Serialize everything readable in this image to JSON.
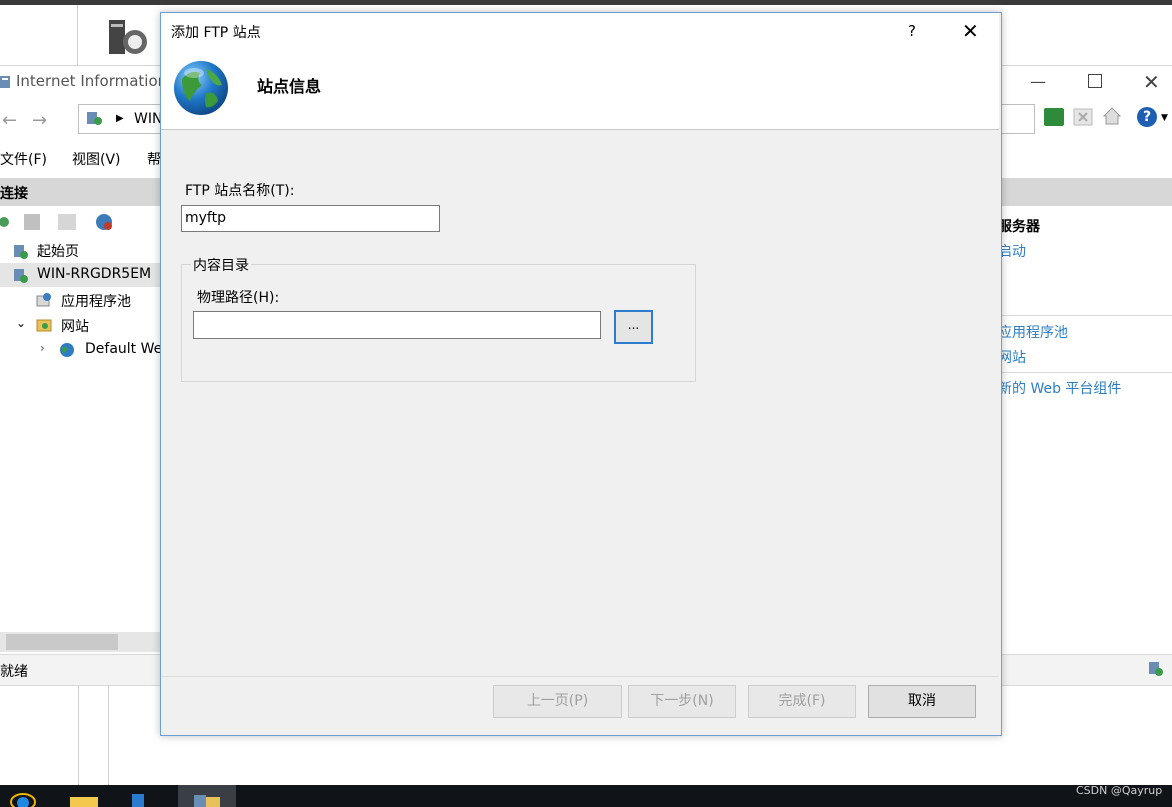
{
  "iis": {
    "window_title": "Internet Information",
    "address_text": "WIN",
    "menu": [
      "文件(F)",
      "视图(V)",
      "帮"
    ],
    "connections_title": "连接",
    "tree": {
      "start_page": "起始页",
      "server": "WIN-RRGDR5EM",
      "app_pools": "应用程序池",
      "sites": "网站",
      "default_site": "Default We"
    },
    "actions": {
      "title": "服务器",
      "start": "启动",
      "view_app_pools": "应用程序池",
      "view_sites": "网站",
      "web_platform": "新的 Web 平台组件"
    },
    "status_text": "就绪"
  },
  "dialog": {
    "title": "添加 FTP 站点",
    "help_glyph": "?",
    "close_glyph": "✕",
    "heading": "站点信息",
    "site_name_label": "FTP 站点名称(T):",
    "site_name_value": "myftp",
    "content_group_label": "内容目录",
    "physical_path_label": "物理路径(H):",
    "physical_path_value": "",
    "browse_label": "...",
    "buttons": {
      "prev": "上一页(P)",
      "next": "下一步(N)",
      "finish": "完成(F)",
      "cancel": "取消"
    }
  },
  "watermark": "CSDN @Qayrup",
  "colors": {
    "dialog_border": "#6c9fd2",
    "link": "#2d7ec4",
    "focus_blue": "#2c7cd0"
  }
}
